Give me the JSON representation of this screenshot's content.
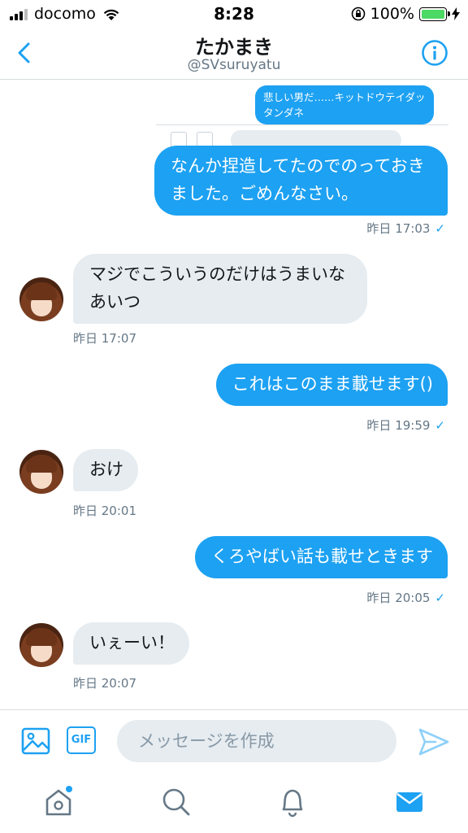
{
  "status_bar": {
    "carrier": "docomo",
    "time": "8:28",
    "battery": "100%",
    "battery_level": 1.0
  },
  "header": {
    "back_icon": "chevron-left-icon",
    "title": "たかまき",
    "handle": "@SVsuruyatu",
    "info_icon": "info-icon"
  },
  "conversation": {
    "quoted_text": "悲しい男だ……キットドウテイダッタンダネ",
    "messages": [
      {
        "direction": "out",
        "text": "なんか捏造してたのでのっておきました。ごめんなさい。",
        "time": "昨日 17:03",
        "read": "✓"
      },
      {
        "direction": "in",
        "text": "マジでこういうのだけはうまいなあいつ",
        "time": "昨日 17:07"
      },
      {
        "direction": "out",
        "text": "これはこのまま載せます()",
        "time": "昨日 19:59",
        "read": "✓"
      },
      {
        "direction": "in",
        "text": "おけ",
        "time": "昨日 20:01"
      },
      {
        "direction": "out",
        "text": "くろやばい話も載せときます",
        "time": "昨日 20:05",
        "read": "✓"
      },
      {
        "direction": "in",
        "text": "いぇーい！",
        "time": "昨日 20:07"
      }
    ]
  },
  "composer": {
    "image_icon": "image-icon",
    "gif_label": "GIF",
    "placeholder": "メッセージを作成",
    "send_icon": "send-icon"
  },
  "tab_bar": {
    "tabs": [
      "home-icon",
      "search-icon",
      "bell-icon",
      "mail-icon"
    ],
    "active": "mail-icon"
  },
  "colors": {
    "accent": "#1da1f2",
    "incoming_bubble": "#e6ecf0",
    "secondary_text": "#657786",
    "battery_green": "#4cd964"
  }
}
